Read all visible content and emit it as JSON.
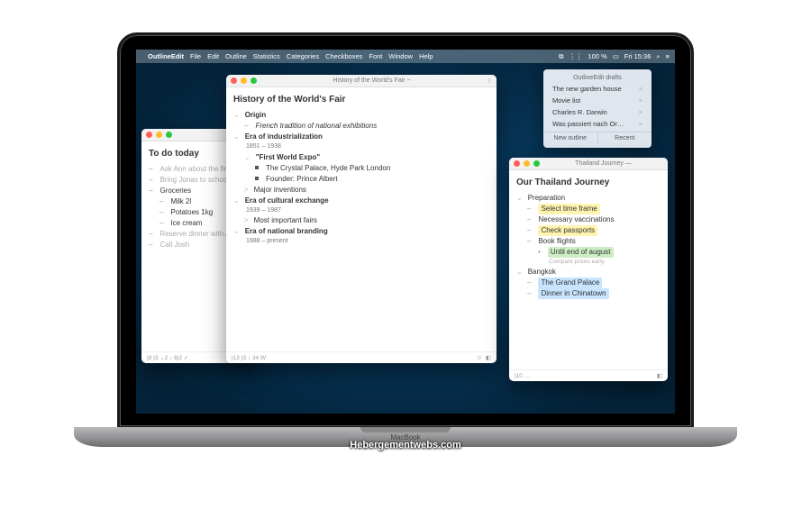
{
  "menubar": {
    "app": "OutlineEdit",
    "items": [
      "File",
      "Edit",
      "Outline",
      "Statistics",
      "Categories",
      "Checkboxes",
      "Font",
      "Window",
      "Help"
    ],
    "right": {
      "battery": "100 %",
      "time": "Fri 15:36"
    }
  },
  "drafts": {
    "title": "OutlineEdit drafts",
    "items": [
      "The new garden house",
      "Movie list",
      "Charles R. Darwin",
      "Was passiert nach Or…"
    ],
    "new": "New outline",
    "recent": "Recent"
  },
  "win_todo": {
    "title": "To do today",
    "items": [
      {
        "t": "Ask Ann about the fina",
        "l": 1,
        "g": true
      },
      {
        "t": "Bring Jonas to school",
        "l": 1,
        "g": true
      },
      {
        "t": "Groceries",
        "l": 1
      },
      {
        "t": "Milk 2l",
        "l": 2
      },
      {
        "t": "Potatoes 1kg",
        "l": 2
      },
      {
        "t": "Ice cream",
        "l": 2
      },
      {
        "t": "Reserve dinner with An",
        "l": 1,
        "g": true
      },
      {
        "t": "Call Josh",
        "l": 1,
        "g": true
      }
    ],
    "footer": "|8  |3  ⌄2  ↕ 6|2 ✓"
  },
  "win_history": {
    "tab": "History of the World's Fair ~",
    "title": "History of the World's Fair",
    "items": [
      {
        "t": "Origin",
        "l": 1,
        "b": true,
        "disc": "⌄"
      },
      {
        "t": "French tradition of national exhibitions",
        "l": 2,
        "it": true
      },
      {
        "t": "Era of industrialization",
        "l": 1,
        "b": true,
        "disc": "⌄"
      },
      {
        "sub": "1851 – 1938"
      },
      {
        "t": "\"First World Expo\"",
        "l": 2,
        "b": true,
        "disc": "⌄"
      },
      {
        "t": "The Crystal Palace, Hyde Park London",
        "l": 3,
        "sq": true
      },
      {
        "t": "Founder: Prince Albert",
        "l": 3,
        "sq": true
      },
      {
        "t": "Major inventions",
        "l": 2,
        "disc": ">"
      },
      {
        "t": "Era of cultural exchange",
        "l": 1,
        "b": true,
        "disc": "⌄"
      },
      {
        "sub": "1939 – 1987"
      },
      {
        "t": "Most important fairs",
        "l": 2,
        "disc": ">"
      },
      {
        "t": "Era of national branding",
        "l": 1,
        "b": true,
        "disc": "⌄"
      },
      {
        "sub": "1988 – present"
      }
    ],
    "footer": "|13  |3  ↕ 34 W"
  },
  "win_thai": {
    "tab": "Thailand Journey —",
    "title": "Our Thailand Journey",
    "items": [
      {
        "t": "Preparation",
        "l": 1,
        "disc": "⌄"
      },
      {
        "t": "Select time frame",
        "l": 2,
        "hl": "y",
        "dash": true
      },
      {
        "t": "Necessary vaccinations",
        "l": 2,
        "dash": true
      },
      {
        "t": "Check passports",
        "l": 2,
        "hl": "y",
        "dash": true
      },
      {
        "t": "Book flights",
        "l": 2,
        "dash": true
      },
      {
        "t": "Until end of august",
        "l": 3,
        "hl": "g",
        "dot": true
      },
      {
        "note": "Compare prices early"
      },
      {
        "t": "Bangkok",
        "l": 1,
        "disc": "⌄"
      },
      {
        "t": "The Grand Palace",
        "l": 2,
        "hl": "b",
        "dash": true
      },
      {
        "t": "Dinner in Chinatown",
        "l": 2,
        "hl": "b",
        "dash": true
      }
    ],
    "footer": "|10  …"
  },
  "watermark": "Hebergementwebs.com",
  "macbook": "MacBook"
}
